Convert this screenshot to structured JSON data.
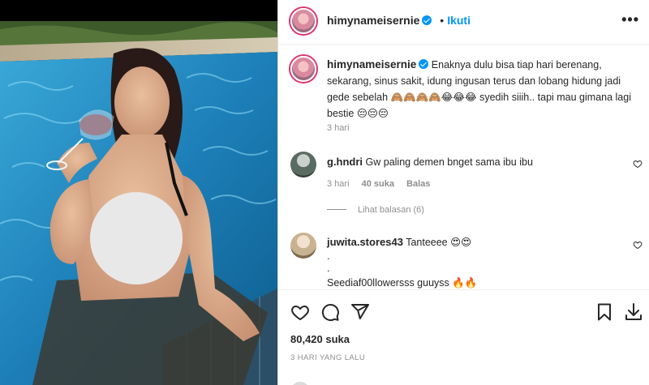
{
  "post": {
    "username": "himynameisernie",
    "follow_label": "Ikuti",
    "separator": "•",
    "more_label": "•••",
    "caption": "Enaknya dulu bisa tiap hari berenang, sekarang, sinus sakit, idung ingusan terus dan lobang hidung jadi gede sebelah 🙈🙈🙈🙈😂😂😂 syedih siiih.. tapi mau gimana lagi bestie 😔😔😔",
    "caption_time": "3 hari",
    "likes": "80,420 suka",
    "posted_time": "3 HARI YANG LALU"
  },
  "comments": [
    {
      "username": "g.hndri",
      "text": "Gw paling demen bnget sama ibu ibu",
      "time": "3 hari",
      "likes": "40 suka",
      "reply_label": "Balas",
      "view_replies": "Lihat balasan (6)"
    },
    {
      "username": "juwita.stores43",
      "text": "Tanteeee 😍😍",
      "line2": ".",
      "line3": ".",
      "line4": "Seediaf00llowersss guuyss 🔥🔥"
    }
  ],
  "icons": {
    "verified": "verified-badge-icon",
    "more": "more-options-icon",
    "like": "heart-icon",
    "comment": "comment-icon",
    "share": "share-icon",
    "save": "bookmark-icon",
    "download": "download-icon"
  },
  "colors": {
    "accent": "#0095f6",
    "text": "#262626",
    "muted": "#8e8e8e",
    "border": "#efefef"
  }
}
